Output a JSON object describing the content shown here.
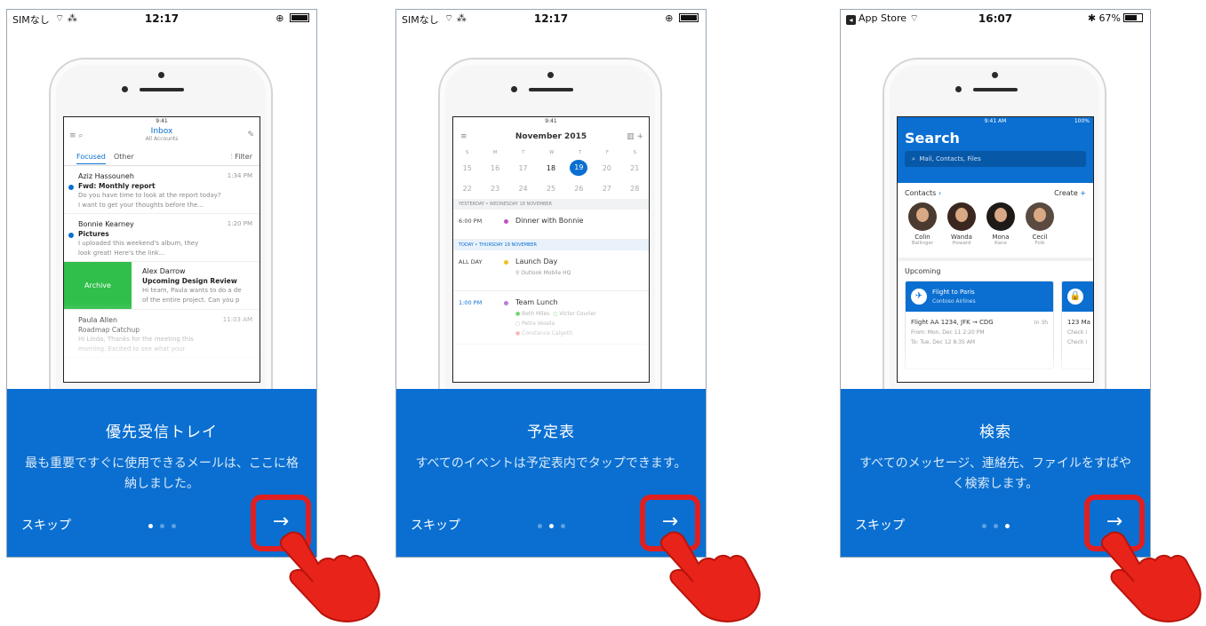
{
  "colors": {
    "accent": "#0a6fd1",
    "highlight": "#e02020",
    "archive": "#2fbf4a"
  },
  "screens": [
    {
      "status": {
        "left": "SIMなし",
        "time": "12:17",
        "battery_level": 1.0
      },
      "title": "優先受信トレイ",
      "description": "最も重要ですぐに使用できるメールは、ここに格納しました。",
      "skip": "スキップ",
      "next_icon": "→",
      "active_page": 0
    },
    {
      "status": {
        "left": "SIMなし",
        "time": "12:17",
        "battery_level": 1.0
      },
      "title": "予定表",
      "description": "すべてのイベントは予定表内でタップできます。",
      "skip": "スキップ",
      "next_icon": "→",
      "active_page": 1
    },
    {
      "status": {
        "left": "App Store",
        "time": "16:07",
        "battery": "67%",
        "battery_level": 0.67
      },
      "title": "検索",
      "description": "すべてのメッセージ、連絡先、ファイルをすばやく検索します。",
      "skip": "スキップ",
      "next_icon": "→",
      "active_page": 2
    }
  ],
  "inbox": {
    "time": "9:41",
    "title": "Inbox",
    "subtitle": "All Accounts",
    "tab_focused": "Focused",
    "tab_other": "Other",
    "filter": "Filter",
    "mails": [
      {
        "from": "Aziz Hassouneh",
        "time": "1:34 PM",
        "subject": "Fwd: Monthly report",
        "p1": "Do you have time to look at the report today?",
        "p2": "I want to get your thoughts before the..."
      },
      {
        "from": "Bonnie Kearney",
        "time": "1:20 PM",
        "subject": "Pictures",
        "p1": "I uploaded this weekend's album, they",
        "p2": "look great! Here's the link..."
      },
      {
        "archive": "Archive",
        "from": "Alex Darrow",
        "subject": "Upcoming Design Review",
        "p1": "Hi team, Paula wants to do a de",
        "p2": "of the entire project. Can you p"
      },
      {
        "from": "Paula Allen",
        "time": "11:03 AM",
        "subject": "Roadmap Catchup",
        "p1": "Hi Linda, Thanks for the meeting this",
        "p2": "morning. Excited to see what your"
      }
    ]
  },
  "calendar": {
    "time": "9:41",
    "month": "November 2015",
    "weekdays": [
      "S",
      "M",
      "T",
      "W",
      "T",
      "F",
      "S"
    ],
    "week1": [
      "15",
      "16",
      "17",
      "18",
      "19",
      "20",
      "21"
    ],
    "week2": [
      "22",
      "23",
      "24",
      "25",
      "26",
      "27",
      "28"
    ],
    "yesterday_header": "YESTERDAY • WEDNESDAY 18 NOVEMBER",
    "today_header": "TODAY • THURSDAY 19 NOVEMBER",
    "events": [
      {
        "time": "6:00 PM",
        "title": "Dinner with Bonnie",
        "color": "#c64fc8"
      },
      {
        "time": "ALL DAY",
        "title": "Launch Day",
        "location": "Outlook Mobile HQ",
        "color": "#f0c020"
      },
      {
        "time": "1:00 PM",
        "title": "Team Lunch",
        "color": "#b67bd8"
      }
    ],
    "attendees": [
      "Beth Miles",
      "Victor Courier",
      "Petra Vesela",
      "Constance Calgetti"
    ]
  },
  "search": {
    "time": "9:41 AM",
    "battery": "100%",
    "title": "Search",
    "placeholder": "Mail, Contacts, Files",
    "contacts_label": "Contacts",
    "create_label": "Create",
    "contacts": [
      {
        "first": "Colin",
        "last": "Ballinger"
      },
      {
        "first": "Wanda",
        "last": "Howard"
      },
      {
        "first": "Mona",
        "last": "Kane"
      },
      {
        "first": "Cecil",
        "last": "Folk"
      }
    ],
    "upcoming": "Upcoming",
    "card1": {
      "title": "Flight to Paris",
      "airline": "Contoso Airlines",
      "flight": "Flight AA 1234, JFK → CDG",
      "in": "In 3h",
      "from": "From: Mon, Dec 11 2:20 PM",
      "to": "To: Tue, Dec 12 8:35 AM"
    },
    "card2": {
      "flight": "123 Ma",
      "g1": "Check i",
      "g2": "Check i"
    }
  }
}
